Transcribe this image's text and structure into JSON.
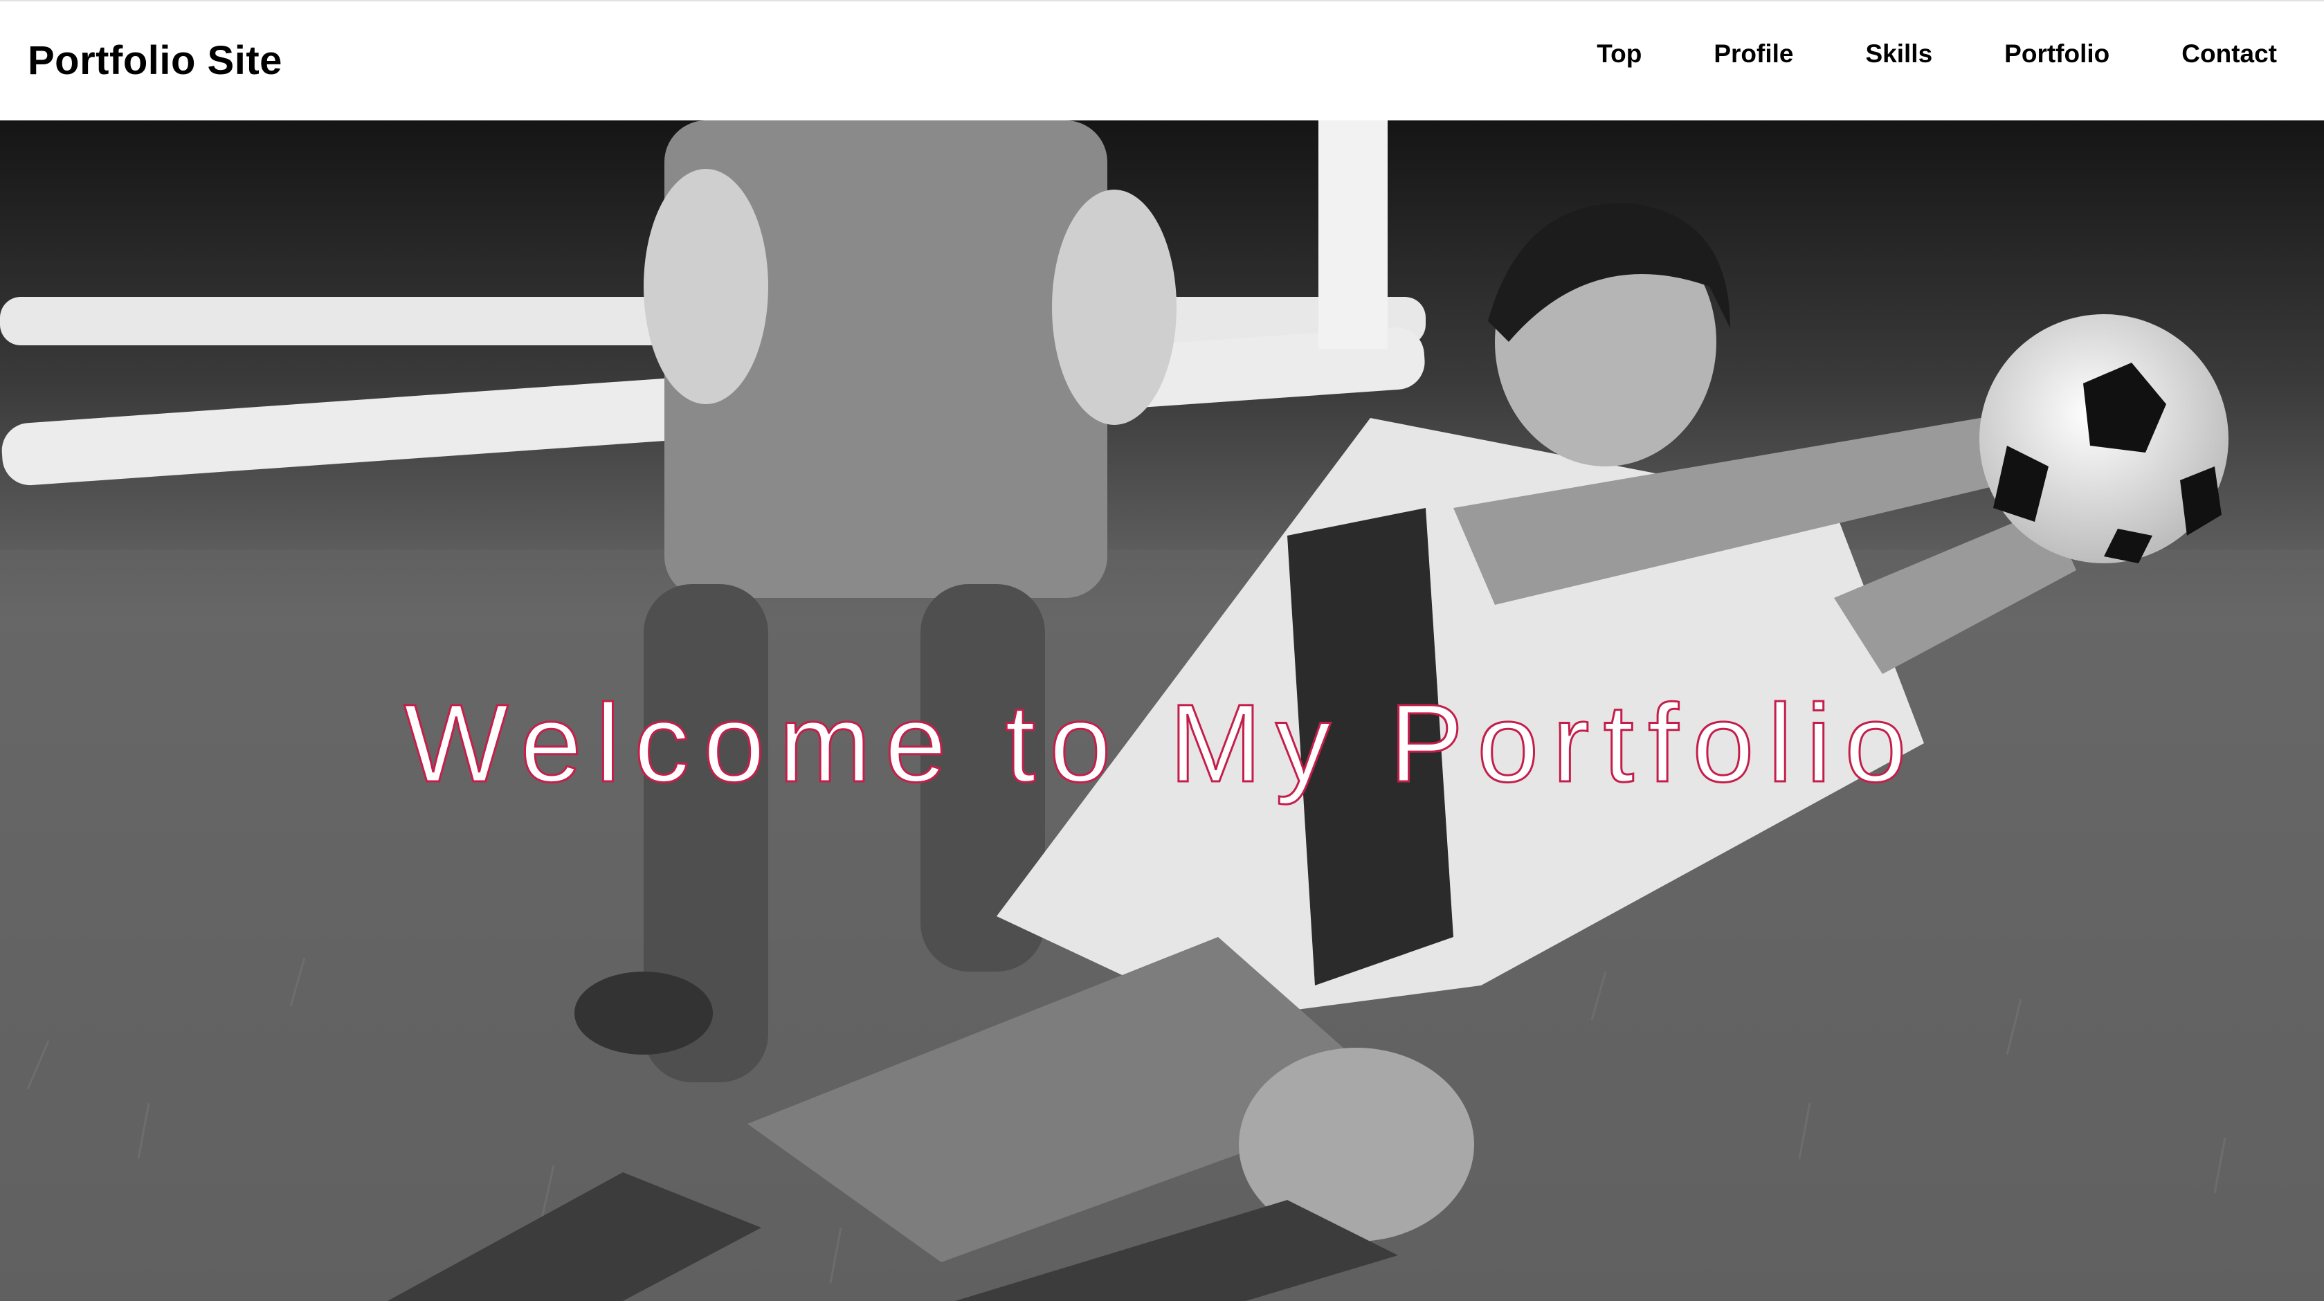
{
  "header": {
    "site_title": "Portfolio Site",
    "nav": [
      {
        "label": "Top"
      },
      {
        "label": "Profile"
      },
      {
        "label": "Skills"
      },
      {
        "label": "Portfolio"
      },
      {
        "label": "Contact"
      }
    ]
  },
  "hero": {
    "heading": "Welcome to My Portfolio",
    "image_description": "black-and-white photo of a young goalkeeper diving to catch a soccer ball in front of a goal, another keeper standing behind",
    "colors": {
      "heading_fill": "#ffffff",
      "heading_outline": "#c41f4b"
    }
  }
}
